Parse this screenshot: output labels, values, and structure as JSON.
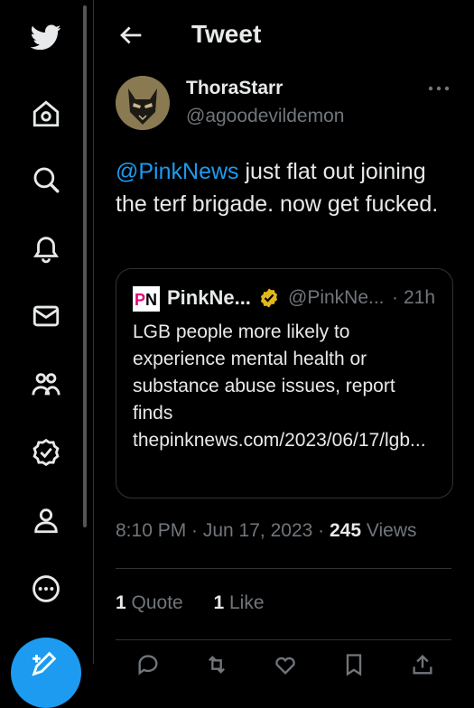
{
  "header": {
    "title": "Tweet"
  },
  "tweet": {
    "author_name": "ThoraStarr",
    "author_handle": "@agoodevildemon",
    "mention": "@PinkNews",
    "body": " just flat out joining the terf brigade.  now get fucked.",
    "timestamp": "8:10 PM · Jun 17, 2023",
    "sep": "·",
    "views_count": "245",
    "views_label": "Views"
  },
  "quoted": {
    "logo_text": "PN",
    "name": "PinkNe...",
    "handle": "@PinkNe...",
    "dot": "·",
    "time": "21h",
    "text": "LGB people more likely to experience mental health or substance abuse issues, report finds",
    "link": "thepinknews.com/2023/06/17/lgb..."
  },
  "stats": {
    "quotes_count": "1",
    "quotes_label": "Quote",
    "likes_count": "1",
    "likes_label": "Like"
  },
  "colors": {
    "accent": "#1d9bf0",
    "muted": "#71767b",
    "text": "#e7e9ea",
    "border": "#2f3336",
    "verified": "#e2b719",
    "pinknews": "#e4007c"
  },
  "icons": [
    "twitter-bird-icon",
    "home-icon",
    "search-icon",
    "bell-icon",
    "mail-icon",
    "communities-icon",
    "verified-icon",
    "profile-icon",
    "more-circle-icon",
    "compose-icon",
    "back-arrow-icon",
    "more-dots-icon"
  ]
}
